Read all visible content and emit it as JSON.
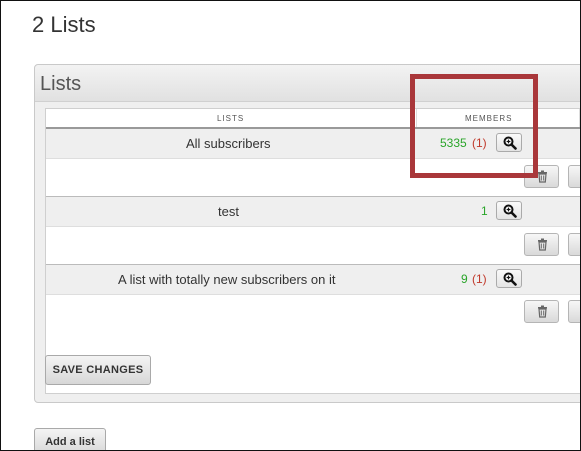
{
  "page": {
    "title": "2 Lists"
  },
  "panel": {
    "title": "Lists"
  },
  "table": {
    "headers": {
      "lists": "LISTS",
      "members": "MEMBERS"
    },
    "rows": [
      {
        "name": "All subscribers",
        "members": "5335",
        "unconfirmed": "(1)"
      },
      {
        "name": "test",
        "members": "1",
        "unconfirmed": ""
      },
      {
        "name": "A list with totally new subscribers on it",
        "members": "9",
        "unconfirmed": "(1)"
      }
    ]
  },
  "buttons": {
    "save": "SAVE CHANGES",
    "add_list": "Add a list"
  },
  "icons": {
    "zoom": "magnifier-icon",
    "delete": "trash-icon"
  },
  "colors": {
    "member_count": "#2aa52a",
    "unconfirmed": "#c0392b",
    "highlight": "#a9373a"
  }
}
